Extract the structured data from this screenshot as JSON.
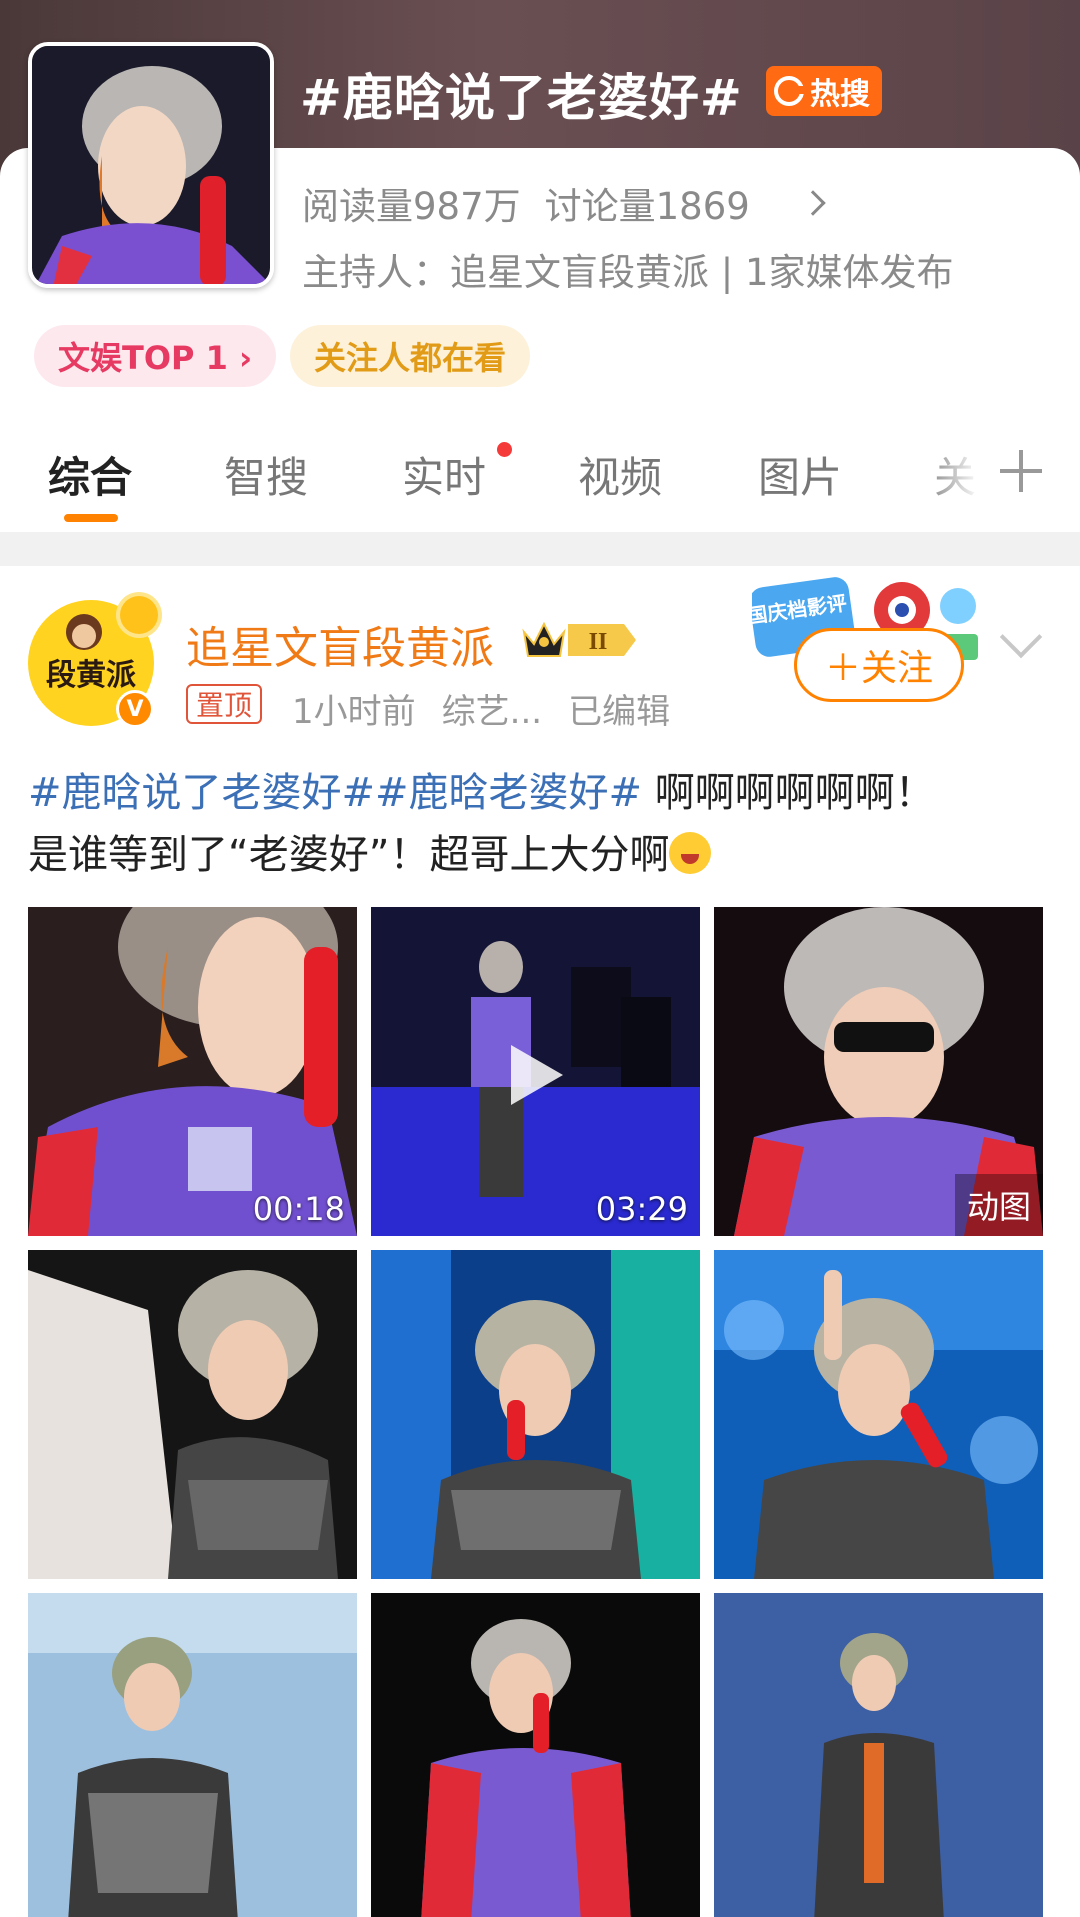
{
  "header": {
    "title": "#鹿晗说了老婆好#",
    "hot_badge": "热搜",
    "reads": "阅读量987万",
    "discussions": "讨论量1869",
    "host": "主持人：追星文盲段黄派 | 1家媒体发布",
    "tag_rank": "文娱TOP 1 ›",
    "tag_follow": "关注人都在看"
  },
  "tabs": [
    {
      "label": "综合"
    },
    {
      "label": "智搜"
    },
    {
      "label": "实时"
    },
    {
      "label": "视频"
    },
    {
      "label": "图片"
    },
    {
      "label": "关"
    }
  ],
  "post": {
    "author": "追星文盲段黄派",
    "avatar_text": "段黄派",
    "level_badge": "II",
    "pin_label": "置顶",
    "time": "1小时前",
    "source": "综艺...",
    "edited": "已编辑",
    "follow_label": "＋关注",
    "hashtag1": "#鹿晗说了老婆好#",
    "hashtag2": "#鹿晗老婆好#",
    "text_line1": " 啊啊啊啊啊啊！",
    "text_line2": "是谁等到了“老婆好”！超哥上大分啊",
    "promo_text": "国庆档影评"
  },
  "grid": [
    {
      "badge": "00:18",
      "type": "video"
    },
    {
      "badge": "03:29",
      "type": "video"
    },
    {
      "badge": "动图",
      "type": "gif"
    },
    {
      "badge": "",
      "type": "image"
    },
    {
      "badge": "",
      "type": "image"
    },
    {
      "badge": "",
      "type": "image"
    },
    {
      "badge": "",
      "type": "image"
    },
    {
      "badge": "",
      "type": "image"
    },
    {
      "badge": "",
      "type": "image"
    }
  ],
  "colors": {
    "accent": "#ff8200",
    "hashtag": "#3b6fb6",
    "hot": "#ff6a13"
  }
}
